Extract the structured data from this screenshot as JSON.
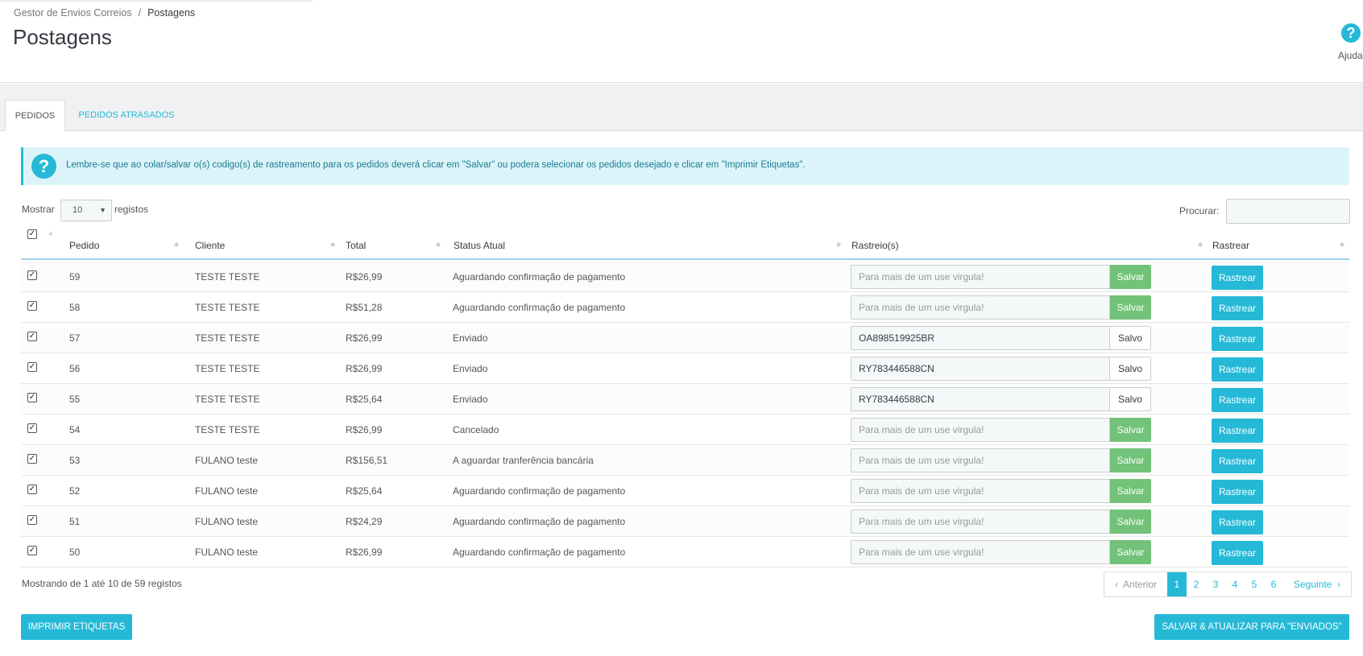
{
  "breadcrumb": {
    "parent": "Gestor de Envios Correios",
    "separator": "/",
    "current": "Postagens"
  },
  "page_title": "Postagens",
  "help": {
    "icon": "?",
    "label": "Ajuda"
  },
  "tabs": [
    {
      "label": "PEDIDOS",
      "active": true
    },
    {
      "label": "PEDIDOS ATRASADOS",
      "active": false
    }
  ],
  "alert": {
    "icon": "?",
    "text": "Lembre-se que ao colar/salvar o(s) codigo(s) de rastreamento para os pedidos deverá clicar em \"Salvar\" ou podera selecionar os pedidos desejado e clicar em \"Imprimir Etiquetas\"."
  },
  "controls": {
    "show_label": "Mostrar",
    "page_size": "10",
    "records_label": "registos",
    "search_label": "Procurar:"
  },
  "columns": [
    "Pedido",
    "Cliente",
    "Total",
    "Status Atual",
    "Rastreio(s)",
    "Rastrear"
  ],
  "track_placeholder": "Para mais de um use virgula!",
  "labels": {
    "save": "Salvar",
    "saved": "Salvo",
    "track": "Rastrear"
  },
  "rows": [
    {
      "pedido": "59",
      "cliente": "TESTE TESTE",
      "total": "R$26,99",
      "status": "Aguardando confirmação de pagamento",
      "tracking": "",
      "saved": false
    },
    {
      "pedido": "58",
      "cliente": "TESTE TESTE",
      "total": "R$51,28",
      "status": "Aguardando confirmação de pagamento",
      "tracking": "",
      "saved": false
    },
    {
      "pedido": "57",
      "cliente": "TESTE TESTE",
      "total": "R$26,99",
      "status": "Enviado",
      "tracking": "OA898519925BR",
      "saved": true
    },
    {
      "pedido": "56",
      "cliente": "TESTE TESTE",
      "total": "R$26,99",
      "status": "Enviado",
      "tracking": "RY783446588CN",
      "saved": true
    },
    {
      "pedido": "55",
      "cliente": "TESTE TESTE",
      "total": "R$25,64",
      "status": "Enviado",
      "tracking": "RY783446588CN",
      "saved": true
    },
    {
      "pedido": "54",
      "cliente": "TESTE TESTE",
      "total": "R$26,99",
      "status": "Cancelado",
      "tracking": "",
      "saved": false
    },
    {
      "pedido": "53",
      "cliente": "FULANO teste",
      "total": "R$156,51",
      "status": "A aguardar tranferência bancária",
      "tracking": "",
      "saved": false
    },
    {
      "pedido": "52",
      "cliente": "FULANO teste",
      "total": "R$25,64",
      "status": "Aguardando confirmação de pagamento",
      "tracking": "",
      "saved": false
    },
    {
      "pedido": "51",
      "cliente": "FULANO teste",
      "total": "R$24,29",
      "status": "Aguardando confirmação de pagamento",
      "tracking": "",
      "saved": false
    },
    {
      "pedido": "50",
      "cliente": "FULANO teste",
      "total": "R$26,99",
      "status": "Aguardando confirmação de pagamento",
      "tracking": "",
      "saved": false
    }
  ],
  "info": "Mostrando de 1 até 10 de 59 registos",
  "pagination": {
    "prev": "Anterior",
    "next": "Seguinte",
    "pages": [
      "1",
      "2",
      "3",
      "4",
      "5",
      "6"
    ],
    "current": "1"
  },
  "actions": {
    "print": "IMPRIMIR ETIQUETAS",
    "update": "SALVAR & ATUALIZAR PARA \"ENVIADOS\""
  },
  "colors": {
    "accent": "#25b9d7",
    "success": "#72c279",
    "alert_bg": "#dcf4f9"
  }
}
